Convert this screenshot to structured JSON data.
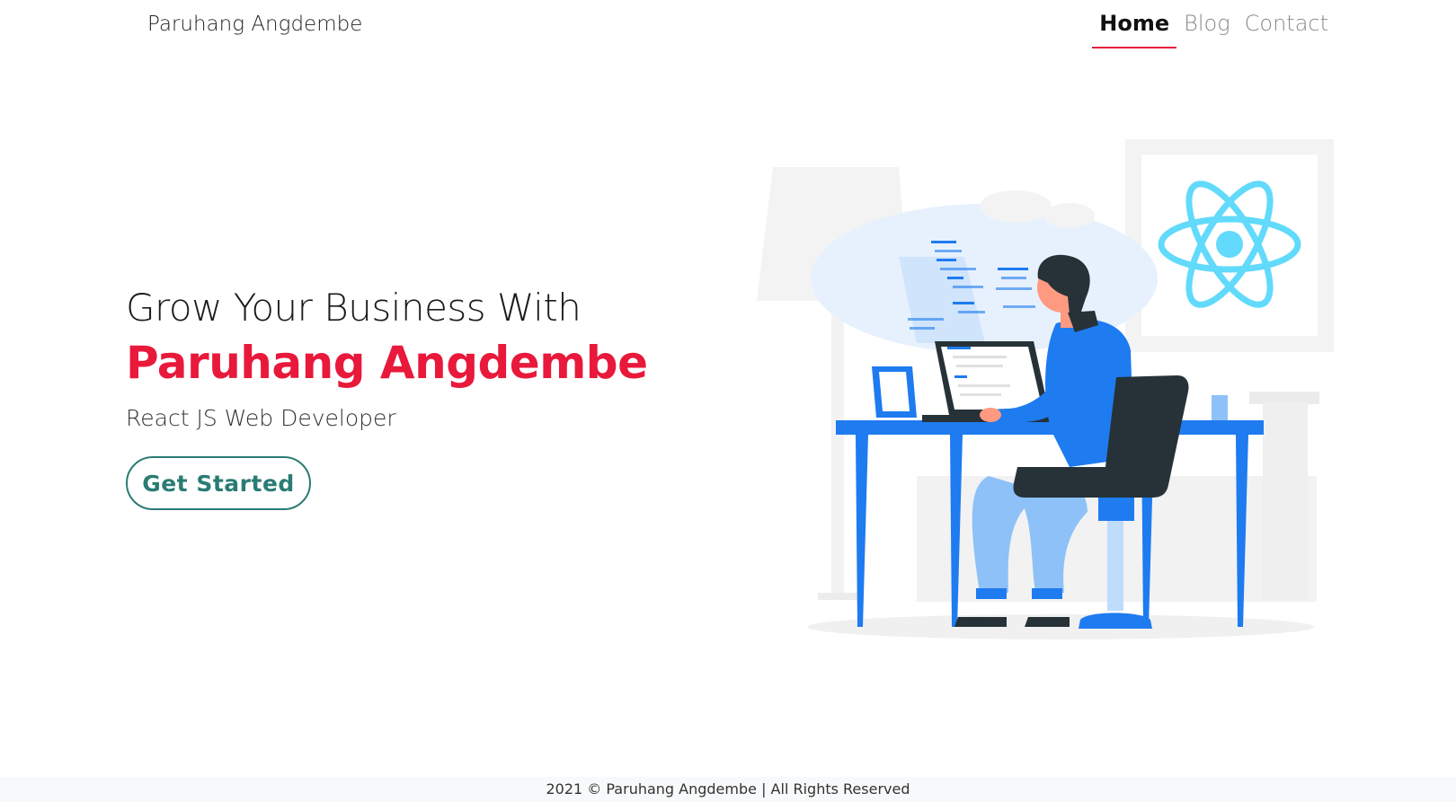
{
  "brand": "Paruhang Angdembe",
  "nav": {
    "home": "Home",
    "blog": "Blog",
    "contact": "Contact"
  },
  "hero": {
    "line1": "Grow Your Business With",
    "line2": "Paruhang Angdembe",
    "subtitle": "React JS Web Developer",
    "cta": "Get Started"
  },
  "footer": "2021 © Paruhang Angdembe | All Rights Reserved",
  "colors": {
    "accent": "#e8193b",
    "button": "#2a7c74",
    "illustration_blue": "#1e7bf0",
    "react_blue": "#61dafb"
  }
}
